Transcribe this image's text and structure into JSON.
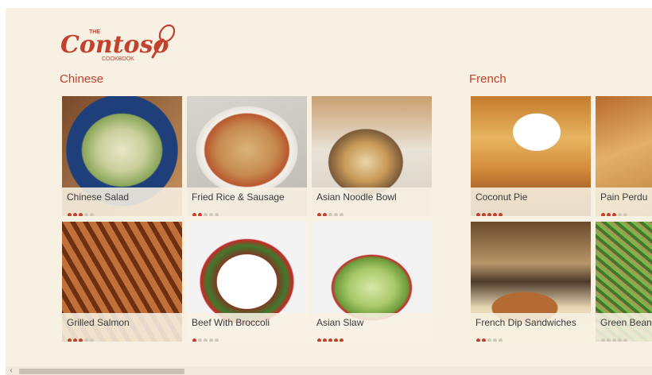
{
  "app": {
    "logo_words": {
      "the": "THE",
      "name": "Contoso",
      "sub": "COOKBOOK"
    },
    "accent": "#c2412c"
  },
  "groups": [
    {
      "title": "Chinese",
      "tiles": [
        {
          "name": "Chinese Salad",
          "rating": 3,
          "scheme": "salad"
        },
        {
          "name": "Fried Rice & Sausage",
          "rating": 2,
          "scheme": "rice"
        },
        {
          "name": "Asian Noodle Bowl",
          "rating": 2,
          "scheme": "noodle"
        },
        {
          "name": "Grilled Salmon",
          "rating": 3,
          "scheme": "salmon"
        },
        {
          "name": "Beef With Broccoli",
          "rating": 1,
          "scheme": "beef"
        },
        {
          "name": "Asian Slaw",
          "rating": 5,
          "scheme": "slaw"
        }
      ]
    },
    {
      "title": "French",
      "tiles": [
        {
          "name": "Coconut Pie",
          "rating": 5,
          "scheme": "pie"
        },
        {
          "name": "Pain Perdu",
          "rating": 3,
          "scheme": "perdu"
        },
        {
          "name": "French Dip Sandwiches",
          "rating": 2,
          "scheme": "dip"
        },
        {
          "name": "Green Beans",
          "rating": 0,
          "scheme": "beans"
        }
      ]
    }
  ],
  "scroll": {
    "left_arrow": "‹",
    "position": 0.2
  }
}
